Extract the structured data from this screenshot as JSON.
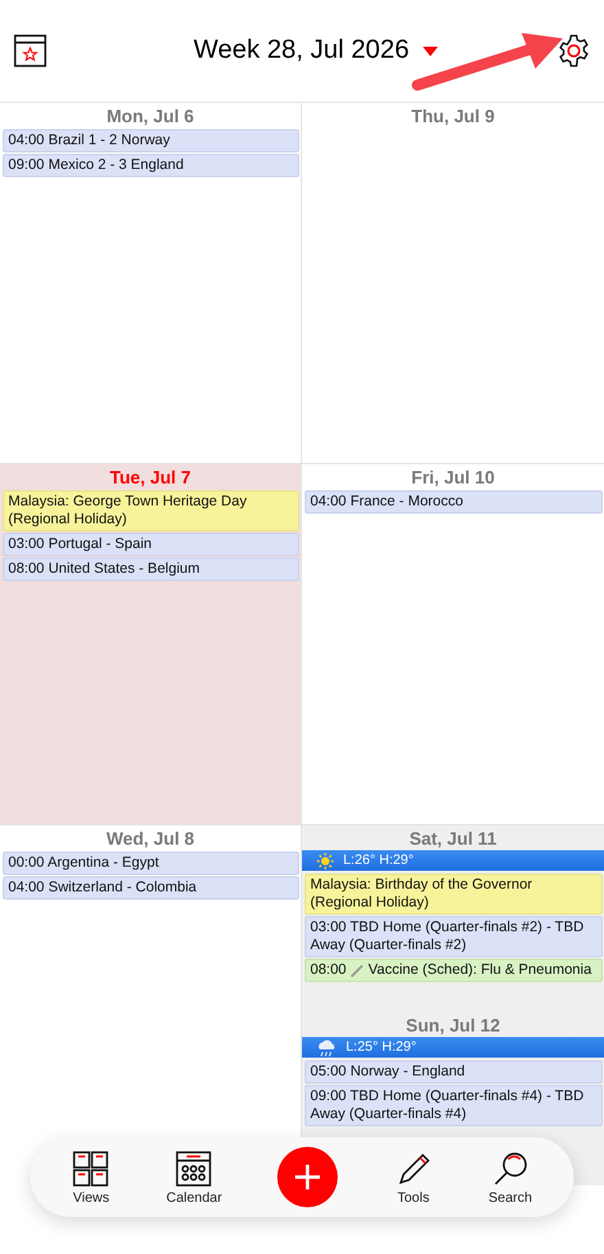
{
  "header": {
    "title": "Week 28, Jul 2026"
  },
  "cells": [
    {
      "days": [
        {
          "label": "Mon, Jul 6",
          "today": false,
          "weekend": false,
          "events": [
            {
              "kind": "match",
              "text": "04:00 Brazil 1 - 2 Norway"
            },
            {
              "kind": "match",
              "text": "09:00 Mexico 2 - 3 England"
            }
          ]
        }
      ]
    },
    {
      "days": [
        {
          "label": "Thu, Jul 9",
          "today": false,
          "weekend": false
        }
      ]
    },
    {
      "days": [
        {
          "label": "Tue, Jul 7",
          "today": true,
          "weekend": false,
          "events": [
            {
              "kind": "holiday",
              "text": "Malaysia: George Town Heritage Day (Regional Holiday)"
            },
            {
              "kind": "match",
              "text": "03:00 Portugal - Spain"
            },
            {
              "kind": "match",
              "text": "08:00 United States - Belgium"
            }
          ]
        }
      ]
    },
    {
      "days": [
        {
          "label": "Fri, Jul 10",
          "today": false,
          "weekend": false,
          "events": [
            {
              "kind": "match",
              "text": "04:00 France - Morocco"
            }
          ]
        }
      ]
    },
    {
      "days": [
        {
          "label": "Wed, Jul 8",
          "today": false,
          "weekend": false,
          "events": [
            {
              "kind": "match",
              "text": "00:00 Argentina - Egypt"
            },
            {
              "kind": "match",
              "text": "04:00 Switzerland - Colombia"
            }
          ]
        }
      ]
    },
    {
      "days": [
        {
          "label": "Sat, Jul 11",
          "today": false,
          "weekend": true,
          "weather": {
            "kind": "sun",
            "text": "L:26° H:29°"
          },
          "events": [
            {
              "kind": "holiday",
              "text": "Malaysia: Birthday of the Governor (Regional Holiday)"
            },
            {
              "kind": "match",
              "text": "03:00 TBD Home (Quarter-finals #2) - TBD Away (Quarter-finals #2)"
            },
            {
              "kind": "vaccine",
              "time": "08:00",
              "text": "Vaccine (Sched): Flu & Pneumonia"
            }
          ]
        },
        {
          "label": "Sun, Jul 12",
          "today": false,
          "weekend": true,
          "weather": {
            "kind": "rain",
            "text": "L:25° H:29°"
          },
          "events": [
            {
              "kind": "match",
              "text": "05:00 Norway - England"
            },
            {
              "kind": "match",
              "text": "09:00 TBD Home (Quarter-finals #4) - TBD Away (Quarter-finals #4)"
            }
          ]
        }
      ]
    }
  ],
  "toolbar": [
    {
      "kind": "views",
      "label": "Views"
    },
    {
      "kind": "calendar",
      "label": "Calendar"
    },
    {
      "kind": "add"
    },
    {
      "kind": "tools",
      "label": "Tools"
    },
    {
      "kind": "search",
      "label": "Search"
    }
  ]
}
